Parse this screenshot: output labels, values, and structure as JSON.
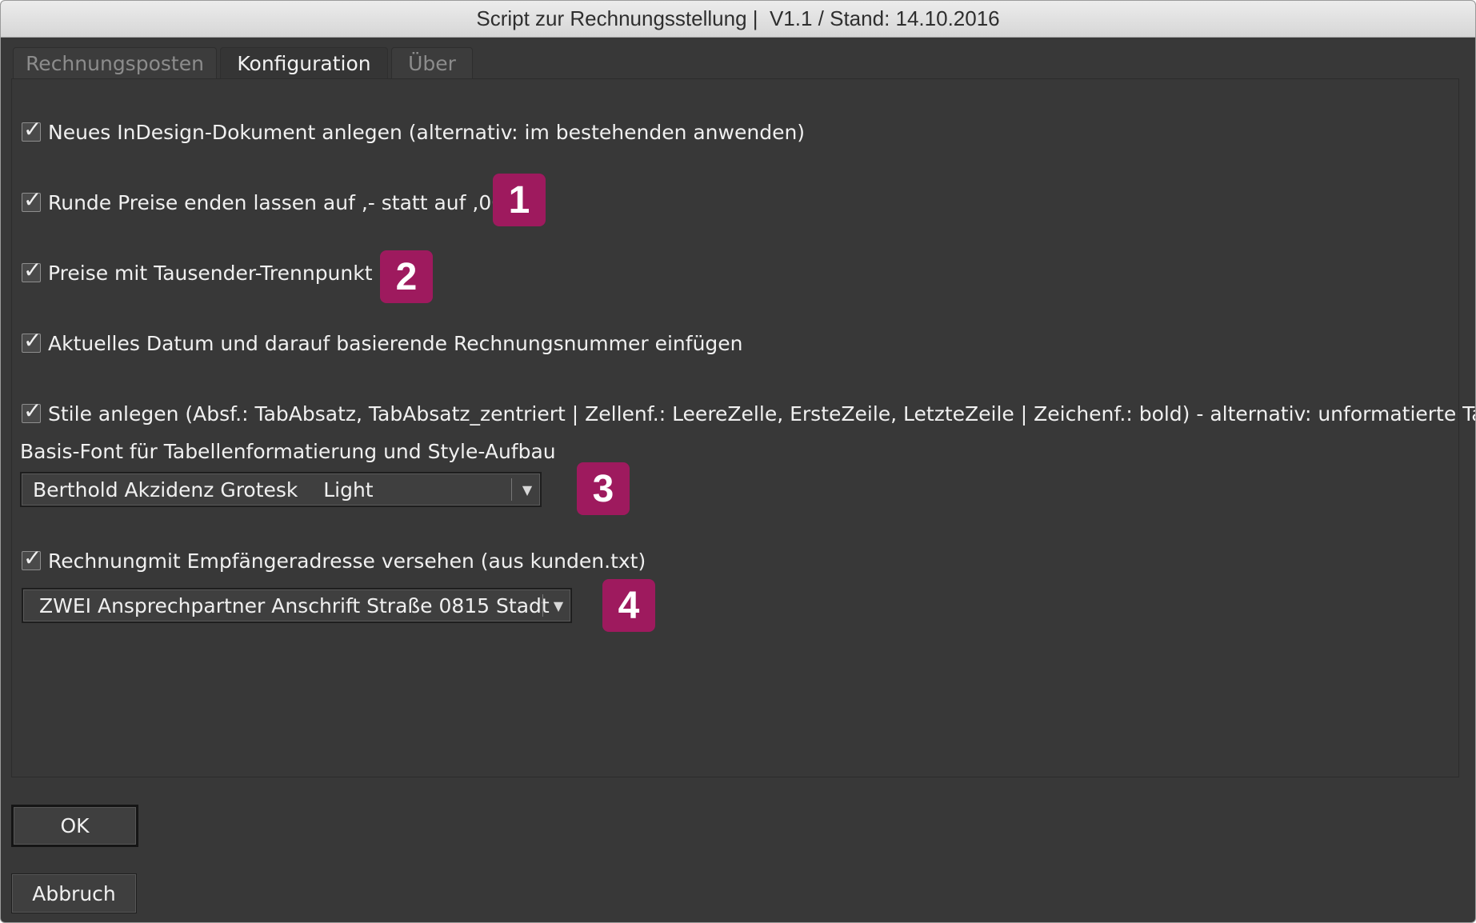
{
  "window": {
    "title": "Script zur Rechnungsstellung |  V1.1 / Stand: 14.10.2016"
  },
  "tabs": [
    {
      "label": "Rechnungsposten",
      "active": false
    },
    {
      "label": "Konfiguration",
      "active": true
    },
    {
      "label": "Über",
      "active": false
    }
  ],
  "options": [
    {
      "label": "Neues InDesign-Dokument anlegen (alternativ: im bestehenden anwenden)",
      "checked": true
    },
    {
      "label": "Runde Preise enden lassen auf ,- statt auf ,00",
      "checked": true
    },
    {
      "label": "Preise mit Tausender-Trennpunkt",
      "checked": true
    },
    {
      "label": "Aktuelles Datum und darauf basierende Rechnungsnummer einfügen",
      "checked": true
    },
    {
      "label": "Stile anlegen (Absf.: TabAbsatz, TabAbsatz_zentriert | Zellenf.: LeereZelle, ErsteZeile, LetzteZeile | Zeichenf.: bold) - alternativ: unformatierte Tabelle",
      "checked": true
    },
    {
      "label": "Rechnungmit Empfängeradresse versehen (aus kunden.txt)",
      "checked": true
    }
  ],
  "font_section": {
    "label": "Basis-Font für Tabellenformatierung und Style-Aufbau",
    "selected": "Berthold Akzidenz Grotesk    Light"
  },
  "address_dropdown": {
    "selected": "ZWEI Ansprechpartner Anschrift Straße 0815 Stadt"
  },
  "badges": [
    "1",
    "2",
    "3",
    "4"
  ],
  "buttons": {
    "ok": "OK",
    "cancel": "Abbruch"
  },
  "colors": {
    "background": "#383838",
    "badge": "#9e1a5e",
    "text": "#f0f0f0"
  },
  "icons": {
    "checkmark": "✓",
    "dropdown_arrow": "▼"
  }
}
